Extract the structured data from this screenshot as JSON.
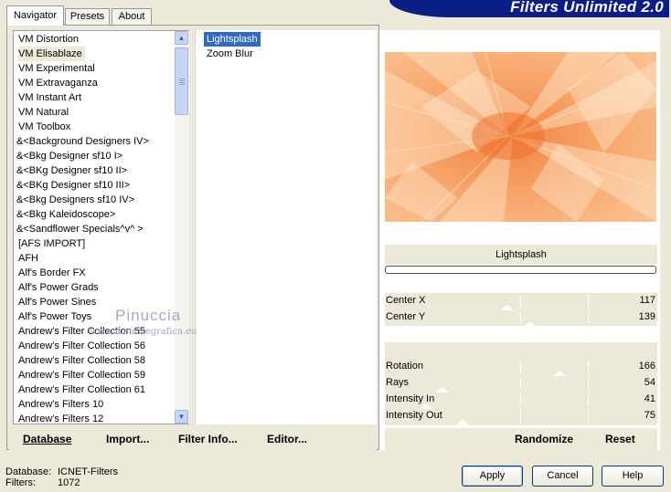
{
  "tabs": [
    {
      "label": "Navigator",
      "active": true
    },
    {
      "label": "Presets",
      "active": false
    },
    {
      "label": "About",
      "active": false
    }
  ],
  "banner": {
    "title": "Filters Unlimited 2.0"
  },
  "categories": [
    "VM Distortion",
    "VM Elisablaze",
    "VM Experimental",
    "VM Extravaganza",
    "VM Instant Art",
    "VM Natural",
    "VM Toolbox",
    "&<Background Designers IV>",
    "&<Bkg Designer sf10 I>",
    "&<BKg Designer sf10 II>",
    "&<BKg Designer sf10 III>",
    "&<Bkg Designers sf10 IV>",
    "&<Bkg Kaleidoscope>",
    "&<Sandflower Specials^v^ >",
    "[AFS IMPORT]",
    "AFH",
    "Alf's Border FX",
    "Alf's Power Grads",
    "Alf's Power Sines",
    "Alf's Power Toys",
    "Andrew's Filter Collection 55",
    "Andrew's Filter Collection 56",
    "Andrew's Filter Collection 58",
    "Andrew's Filter Collection 59",
    "Andrew's Filter Collection 61",
    "Andrew's Filters 10",
    "Andrew's Filters 12"
  ],
  "selected_category": "VM Elisablaze",
  "filters": [
    "Lightsplash",
    "Zoom Blur"
  ],
  "selected_filter": "Lightsplash",
  "left_buttons": {
    "database": "Database",
    "import": "Import...",
    "filter_info": "Filter Info...",
    "editor": "Editor..."
  },
  "effect_name": "Lightsplash",
  "params": [
    {
      "label": "Center X",
      "value": "117"
    },
    {
      "label": "Center Y",
      "value": "139"
    },
    {
      "label": "Rotation",
      "value": "166"
    },
    {
      "label": "Rays",
      "value": "54"
    },
    {
      "label": "Intensity In",
      "value": "41"
    },
    {
      "label": "Intensity Out",
      "value": "75"
    }
  ],
  "right_buttons": {
    "randomize": "Randomize",
    "reset": "Reset"
  },
  "watermark": {
    "name": "Pinuccia",
    "site": "www.maidiregrafica.eu"
  },
  "status": {
    "database_label": "Database:",
    "database_value": "ICNET-Filters",
    "filters_label": "Filters:",
    "filters_value": "1072"
  },
  "dialog_buttons": {
    "apply": "Apply",
    "cancel": "Cancel",
    "help": "Help"
  },
  "colors": {
    "banner": "#0a1e86",
    "selection": "#316ac5",
    "preview_base": "#f9b581"
  }
}
